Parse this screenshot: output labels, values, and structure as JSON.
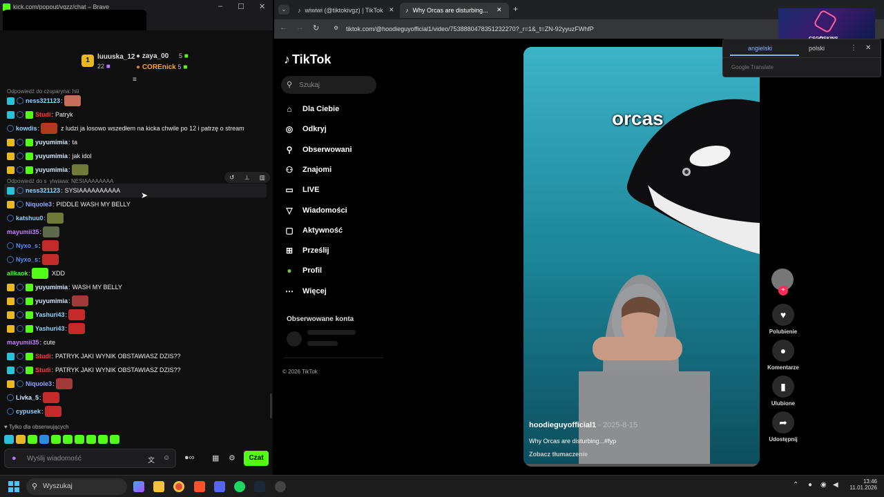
{
  "left_window": {
    "title": "kick.com/popout/vgzz/chat – Brave",
    "leaderboard": [
      {
        "rank": "1",
        "name": "luuuska_12",
        "count": "22"
      },
      {
        "name": "zaya_00",
        "count": "5"
      },
      {
        "name": "COREnick",
        "count": "5"
      }
    ],
    "chat": [
      {
        "reply": "Odpowiedź do czuparyna: hiii",
        "user": "ness321123",
        "text": "",
        "ucolor": "#8fd3ff",
        "badges": [
          "kick",
          "ring"
        ],
        "emote": "#c96b5a"
      },
      {
        "user": "Studi",
        "text": "Patryk",
        "ucolor": "#ff3b3b",
        "badges": [
          "kick",
          "ring",
          "gift"
        ]
      },
      {
        "user": "kowdis",
        "text": "z ludzi ja losowo wszedłem na kicka chwile po 12 i patrzę o stream",
        "ucolor": "#8fd3ff",
        "badges": [
          "ring"
        ],
        "emote": "#b03a1a"
      },
      {
        "user": "yuyumimia",
        "text": "ta",
        "ucolor": "#cfe8ff",
        "badges": [
          "sub",
          "ring",
          "gift"
        ]
      },
      {
        "user": "yuyumimia",
        "text": "jak idol",
        "ucolor": "#cfe8ff",
        "badges": [
          "sub",
          "ring",
          "gift"
        ]
      },
      {
        "user": "yuyumimia",
        "text": "",
        "ucolor": "#cfe8ff",
        "badges": [
          "sub",
          "ring",
          "gift"
        ],
        "emote": "#6f7a3a"
      },
      {
        "reply": "Odpowiedź do s_ylwiaaa: NESIAAAAAAAA",
        "user": "ness321123",
        "text": "SYSIAAAAAAAAAA",
        "ucolor": "#8fd3ff",
        "badges": [
          "kick",
          "ring"
        ],
        "highlight": true
      },
      {
        "user": "Niquole3",
        "text": "PIDDLE WASH MY BELLY",
        "ucolor": "#8fa8ff",
        "badges": [
          "sub",
          "ring"
        ]
      },
      {
        "user": "katshuu0",
        "text": "",
        "ucolor": "#8fd3ff",
        "badges": [
          "ring"
        ],
        "emote": "#6f7a3a"
      },
      {
        "user": "mayumii35",
        "text": "",
        "ucolor": "#c07cff",
        "badges": [],
        "emote": "#5d6a4a"
      },
      {
        "user": "Nyxo_s",
        "text": "",
        "ucolor": "#5a8cff",
        "badges": [
          "ring"
        ],
        "emote": "#c42a2a"
      },
      {
        "user": "Nyxo_s",
        "text": "",
        "ucolor": "#5a8cff",
        "badges": [
          "ring"
        ],
        "emote": "#c42a2a"
      },
      {
        "user": "allkaok",
        "text": "XDD",
        "ucolor": "#53fc18",
        "badges": [],
        "emote": "#53fc18"
      },
      {
        "user": "yuyumimia",
        "text": "WASH MY BELLY",
        "ucolor": "#cfe8ff",
        "badges": [
          "sub",
          "ring",
          "gift"
        ]
      },
      {
        "user": "yuyumimia",
        "text": "",
        "ucolor": "#cfe8ff",
        "badges": [
          "sub",
          "ring",
          "gift"
        ],
        "emote": "#a23a3a"
      },
      {
        "user": "Yashuri43",
        "text": "",
        "ucolor": "#8fd3ff",
        "badges": [
          "sub",
          "ring",
          "gift"
        ],
        "emote": "#c42a2a"
      },
      {
        "user": "Yashuri43",
        "text": "",
        "ucolor": "#8fd3ff",
        "badges": [
          "sub",
          "ring",
          "gift"
        ],
        "emote": "#c42a2a"
      },
      {
        "user": "mayumii35",
        "text": "cute",
        "ucolor": "#c07cff",
        "badges": []
      },
      {
        "user": "Studi",
        "text": "PATRYK JAKI WYNIK OBSTAWIASZ DZIS??",
        "ucolor": "#ff3b3b",
        "badges": [
          "kick",
          "ring",
          "gift"
        ]
      },
      {
        "user": "Studi",
        "text": "PATRYK JAKI WYNIK OBSTAWIASZ DZIS??",
        "ucolor": "#ff3b3b",
        "badges": [
          "kick",
          "ring",
          "gift"
        ]
      },
      {
        "user": "Niquole3",
        "text": "",
        "ucolor": "#8fa8ff",
        "badges": [
          "sub",
          "ring"
        ],
        "emote": "#a23a3a"
      },
      {
        "user": "Livka_5",
        "text": "",
        "ucolor": "#cfe8ff",
        "badges": [
          "ring"
        ],
        "emote": "#c42a2a"
      },
      {
        "user": "cypusek",
        "text": "",
        "ucolor": "#8fd3ff",
        "badges": [
          "ring"
        ],
        "emote": "#c42a2a"
      }
    ],
    "followers_only": "Tylko dla obserwujących",
    "input_placeholder": "Wyślij wiadomość",
    "send_label": "Czat"
  },
  "right_window": {
    "tabs": [
      {
        "label": "wiwiwi (@tiktokivgz) | TikTok"
      },
      {
        "label": "Why Orcas are disturbing..."
      }
    ],
    "url": "tiktok.com/@hoodieguyofficial1/video/7538880478351232270?_r=1&_t=ZN-92yyuzFWhfP",
    "logo": "TikTok",
    "search_placeholder": "Szukaj",
    "nav": [
      {
        "label": "Dla Ciebie",
        "icon": "home-icon",
        "glyph": "⌂"
      },
      {
        "label": "Odkryj",
        "icon": "compass-icon",
        "glyph": "◎"
      },
      {
        "label": "Obserwowani",
        "icon": "user-follow-icon",
        "glyph": "⚲"
      },
      {
        "label": "Znajomi",
        "icon": "friends-icon",
        "glyph": "⚇"
      },
      {
        "label": "LIVE",
        "icon": "live-icon",
        "glyph": "▭"
      },
      {
        "label": "Wiadomości",
        "icon": "send-icon",
        "glyph": "▽"
      },
      {
        "label": "Aktywność",
        "icon": "activity-icon",
        "glyph": "▢"
      },
      {
        "label": "Prześlij",
        "icon": "upload-icon",
        "glyph": "⊞"
      },
      {
        "label": "Profil",
        "icon": "profile-avatar-icon",
        "glyph": "●"
      },
      {
        "label": "Więcej",
        "icon": "more-icon",
        "glyph": "⋯"
      }
    ],
    "followed_accounts": "Obserwowane konta",
    "copyright": "© 2026 TikTok",
    "video": {
      "caption_overlay": "orcas",
      "author": "hoodieguyofficial1",
      "date": "2025-8-15",
      "description": "Why Orcas are disturbing...#fyp",
      "translate": "Zobacz tłumaczenie"
    },
    "actions": [
      {
        "label": "Polubienie",
        "icon": "heart-icon",
        "glyph": "♥"
      },
      {
        "label": "Komentarze",
        "icon": "comment-icon",
        "glyph": "●"
      },
      {
        "label": "Ulubione",
        "icon": "bookmark-icon",
        "glyph": "▮"
      },
      {
        "label": "Udostępnij",
        "icon": "share-icon",
        "glyph": "➦"
      }
    ],
    "translate_popup": {
      "tab1": "angielski",
      "tab2": "polski",
      "footer": "Google Translate"
    },
    "ad_label": "CSG✪SKINS"
  },
  "taskbar": {
    "search": "Wyszukaj",
    "time": "13:46",
    "date": "11.01.2026"
  }
}
